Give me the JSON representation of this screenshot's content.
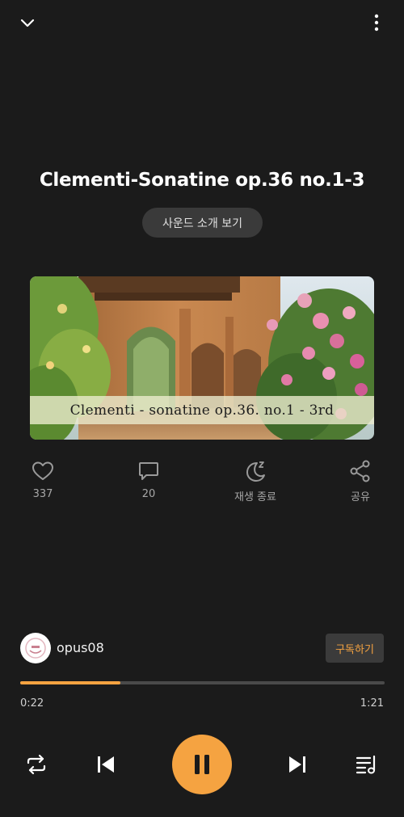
{
  "track": {
    "title": "Clementi-Sonatine op.36 no.1-3",
    "intro_button": "사운드 소개 보기",
    "cover_caption": "Clementi - sonatine op.36. no.1 - 3rd"
  },
  "actions": {
    "like_count": "337",
    "comment_count": "20",
    "sleep_label": "재생 종료",
    "share_label": "공유"
  },
  "channel": {
    "name": "opus08",
    "subscribe_label": "구독하기"
  },
  "player": {
    "progress": 0.276,
    "current_time": "0:22",
    "total_time": "1:21"
  },
  "colors": {
    "accent": "#f5a341",
    "background": "#1b1b1b"
  },
  "icons": {
    "top_left": "chevron-down-icon",
    "top_right": "more-vertical-icon",
    "like": "heart-icon",
    "comment": "comment-icon",
    "sleep": "moon-icon",
    "share": "share-icon",
    "repeat": "repeat-icon",
    "prev": "skip-previous-icon",
    "play": "pause-icon",
    "next": "skip-next-icon",
    "playlist": "playlist-icon"
  }
}
